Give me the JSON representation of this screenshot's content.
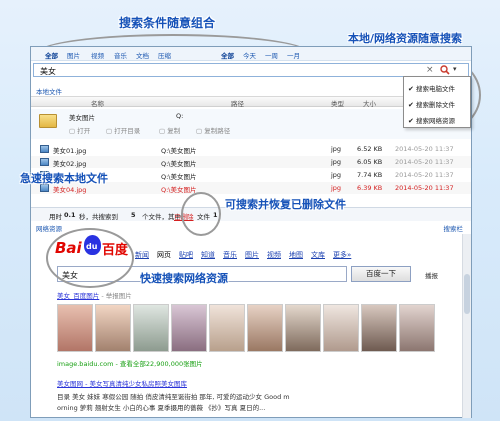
{
  "annotations": {
    "combo_search": "搜索条件随意组合",
    "source_select": "本地/网络资源随意搜索",
    "fast_local": "急速搜索本地文件",
    "recover": "可搜索并恢复已删除文件",
    "fast_web": "快速搜索网络资源"
  },
  "filter": {
    "types": [
      "全部",
      "图片",
      "视频",
      "音乐",
      "文档",
      "压缩"
    ],
    "times": [
      "全部",
      "今天",
      "一周",
      "一月"
    ]
  },
  "search": {
    "value": "美女",
    "clear": "×"
  },
  "local": {
    "title": "本地文件",
    "columns": [
      "名称",
      "路径",
      "类型",
      "大小"
    ],
    "folder": {
      "name": "美女图片",
      "path": "Q:",
      "actions": [
        "打开",
        "打开目录",
        "复制",
        "复制路径"
      ]
    },
    "files": [
      {
        "name": "美女01.jpg",
        "path": "Q:\\美女图片",
        "type": "jpg",
        "size": "6.52 KB",
        "date": "2014-05-20 11:37",
        "deleted": false
      },
      {
        "name": "美女02.jpg",
        "path": "Q:\\美女图片",
        "type": "jpg",
        "size": "6.05 KB",
        "date": "2014-05-20 11:37",
        "deleted": false
      },
      {
        "name": "美女03.jpg",
        "path": "Q:\\美女图片",
        "type": "jpg",
        "size": "7.74 KB",
        "date": "2014-05-20 11:37",
        "deleted": false
      },
      {
        "name": "美女04.jpg",
        "path": "Q:\\美女图片",
        "type": "jpg",
        "size": "6.39 KB",
        "date": "2014-05-20 11:37",
        "deleted": true
      }
    ],
    "status": {
      "time_prefix": "用时",
      "time": "0.1",
      "time_suffix": "秒，共搜索到",
      "count": "5",
      "count_suffix": "个文件，其中",
      "deleted_label": "已删除",
      "deleted_suffix": "文件",
      "deleted_count": "1"
    }
  },
  "web": {
    "title": "网络资源",
    "nav_right": "搜索栏",
    "tabs": [
      "新闻",
      "网页",
      "贴吧",
      "知道",
      "音乐",
      "图片",
      "视频",
      "地图",
      "文库",
      "更多»"
    ],
    "active_tab": "网页",
    "query": "美女",
    "search_button": "百度一下",
    "sidebar_label": "播报",
    "result1_title": "美女_百度图片",
    "result1_suffix": " - 举报图片",
    "images_caption": "image.baidu.com - 查看全部22,900,000张图片",
    "result2_title": "美女图网 - 美女写真清纯少女私房照美女图库",
    "snippet_line1": "目录 美女 妹妹 寒假公园 随拍 俏皮清纯至诞街拍 那年, 可爱的运动少女 Good m",
    "snippet_line2": "orning 萝莉 翘射女生 小白的心事 夏季摄用的蔷薇 《抄》写真 夏日的..."
  },
  "menu": {
    "items": [
      "搜索电脑文件",
      "搜索删除文件",
      "搜索网络资源"
    ]
  },
  "logo": {
    "text_left": "Bai",
    "text_mid": "du",
    "text_right": "百度"
  }
}
